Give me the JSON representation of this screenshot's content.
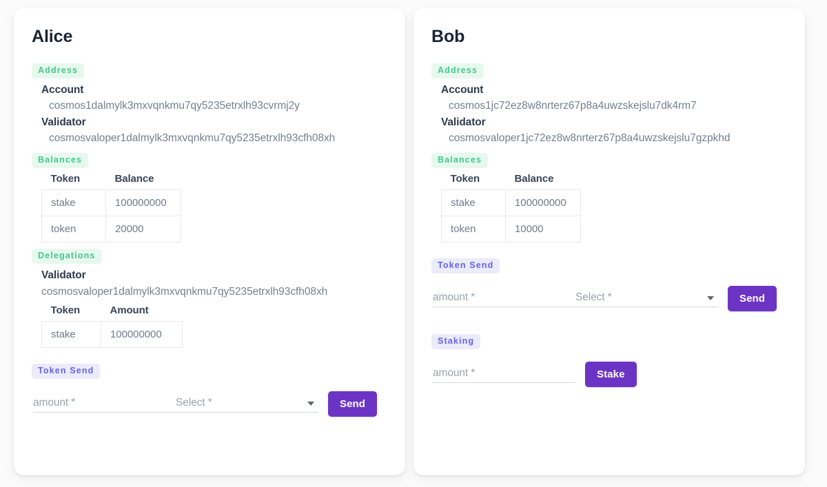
{
  "theme": {
    "page_background": "#fbfbfb",
    "card_background": "#ffffff",
    "badge_green_bg": "#e7f9ef",
    "badge_green_text": "#43c98b",
    "badge_violet_bg": "#ebebfb",
    "badge_violet_text": "#6761e8",
    "button_purple": "#6c34c4",
    "title_color": "#1b2436"
  },
  "labels": {
    "account": "Account",
    "validator": "Validator",
    "token_col": "Token",
    "balance_col": "Balance",
    "amount_col": "Amount"
  },
  "sections": {
    "address": "Address",
    "balances": "Balances",
    "delegations": "Delegations",
    "token_send": "Token Send",
    "staking": "Staking"
  },
  "form": {
    "amount_placeholder": "amount *",
    "select_placeholder": "Select *",
    "amount_value": "",
    "select_value": "",
    "send_label": "Send",
    "stake_label": "Stake",
    "caret_icon": "chevron-down-icon"
  },
  "cards": [
    {
      "title": "Alice",
      "address": {
        "account_label": "Account",
        "account": "cosmos1dalmylk3mxvqnkmu7qy5235etrxlh93cvrmj2y",
        "validator_label": "Validator",
        "validator": "cosmosvaloper1dalmylk3mxvqnkmu7qy5235etrxlh93cfh08xh"
      },
      "balances": {
        "columns": [
          "Token",
          "Balance"
        ],
        "rows": [
          [
            "stake",
            "100000000"
          ],
          [
            "token",
            "20000"
          ]
        ]
      },
      "delegations": {
        "validator_label": "Validator",
        "validator": "cosmosvaloper1dalmylk3mxvqnkmu7qy5235etrxlh93cfh08xh",
        "columns": [
          "Token",
          "Amount"
        ],
        "rows": [
          [
            "stake",
            "100000000"
          ]
        ]
      },
      "has_delegations": true,
      "has_staking": false
    },
    {
      "title": "Bob",
      "address": {
        "account_label": "Account",
        "account": "cosmos1jc72ez8w8nrterz67p8a4uwzskejslu7dk4rm7",
        "validator_label": "Validator",
        "validator": "cosmosvaloper1jc72ez8w8nrterz67p8a4uwzskejslu7gzpkhd"
      },
      "balances": {
        "columns": [
          "Token",
          "Balance"
        ],
        "rows": [
          [
            "stake",
            "100000000"
          ],
          [
            "token",
            "10000"
          ]
        ]
      },
      "has_delegations": false,
      "has_staking": true
    }
  ]
}
